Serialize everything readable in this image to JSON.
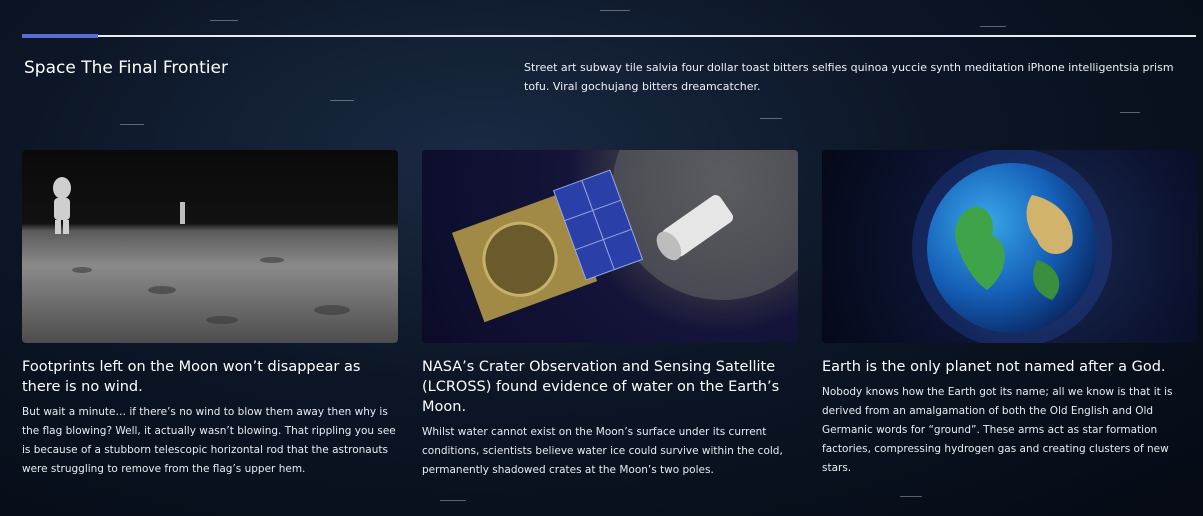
{
  "header": {
    "title": "Space The Final Frontier",
    "intro": "Street art subway tile salvia four dollar toast bitters selfies quinoa yuccie synth meditation iPhone intelligentsia prism tofu. Viral gochujang bitters dreamcatcher."
  },
  "cards": [
    {
      "title": "Footprints left on the Moon won’t disappear as there is no wind.",
      "body": "But wait a minute… if there’s no wind to blow them away then why is the flag blowing? Well, it actually wasn’t blowing. That rippling you see is because of a stubborn telescopic horizontal rod that the astronauts were struggling to remove from the flag’s upper hem."
    },
    {
      "title": "NASA’s Crater Observation and Sensing Satellite (LCROSS) found evidence of water on the Earth’s Moon.",
      "body": "Whilst water cannot exist on the Moon’s surface under its current conditions, scientists believe water ice could survive within the cold, permanently shadowed crates at the Moon’s two poles."
    },
    {
      "title": "Earth is the only planet not named after a God.",
      "body": "Nobody knows how the Earth got its name; all we know is that it is derived from an amalgamation of both the Old English and Old Germanic words for “ground”. These arms act as star formation factories, compressing hydrogen gas and creating clusters of new stars."
    }
  ],
  "colors": {
    "accent": "#5b6bd6",
    "divider": "#e8ecf2",
    "background": "#0c1626"
  }
}
